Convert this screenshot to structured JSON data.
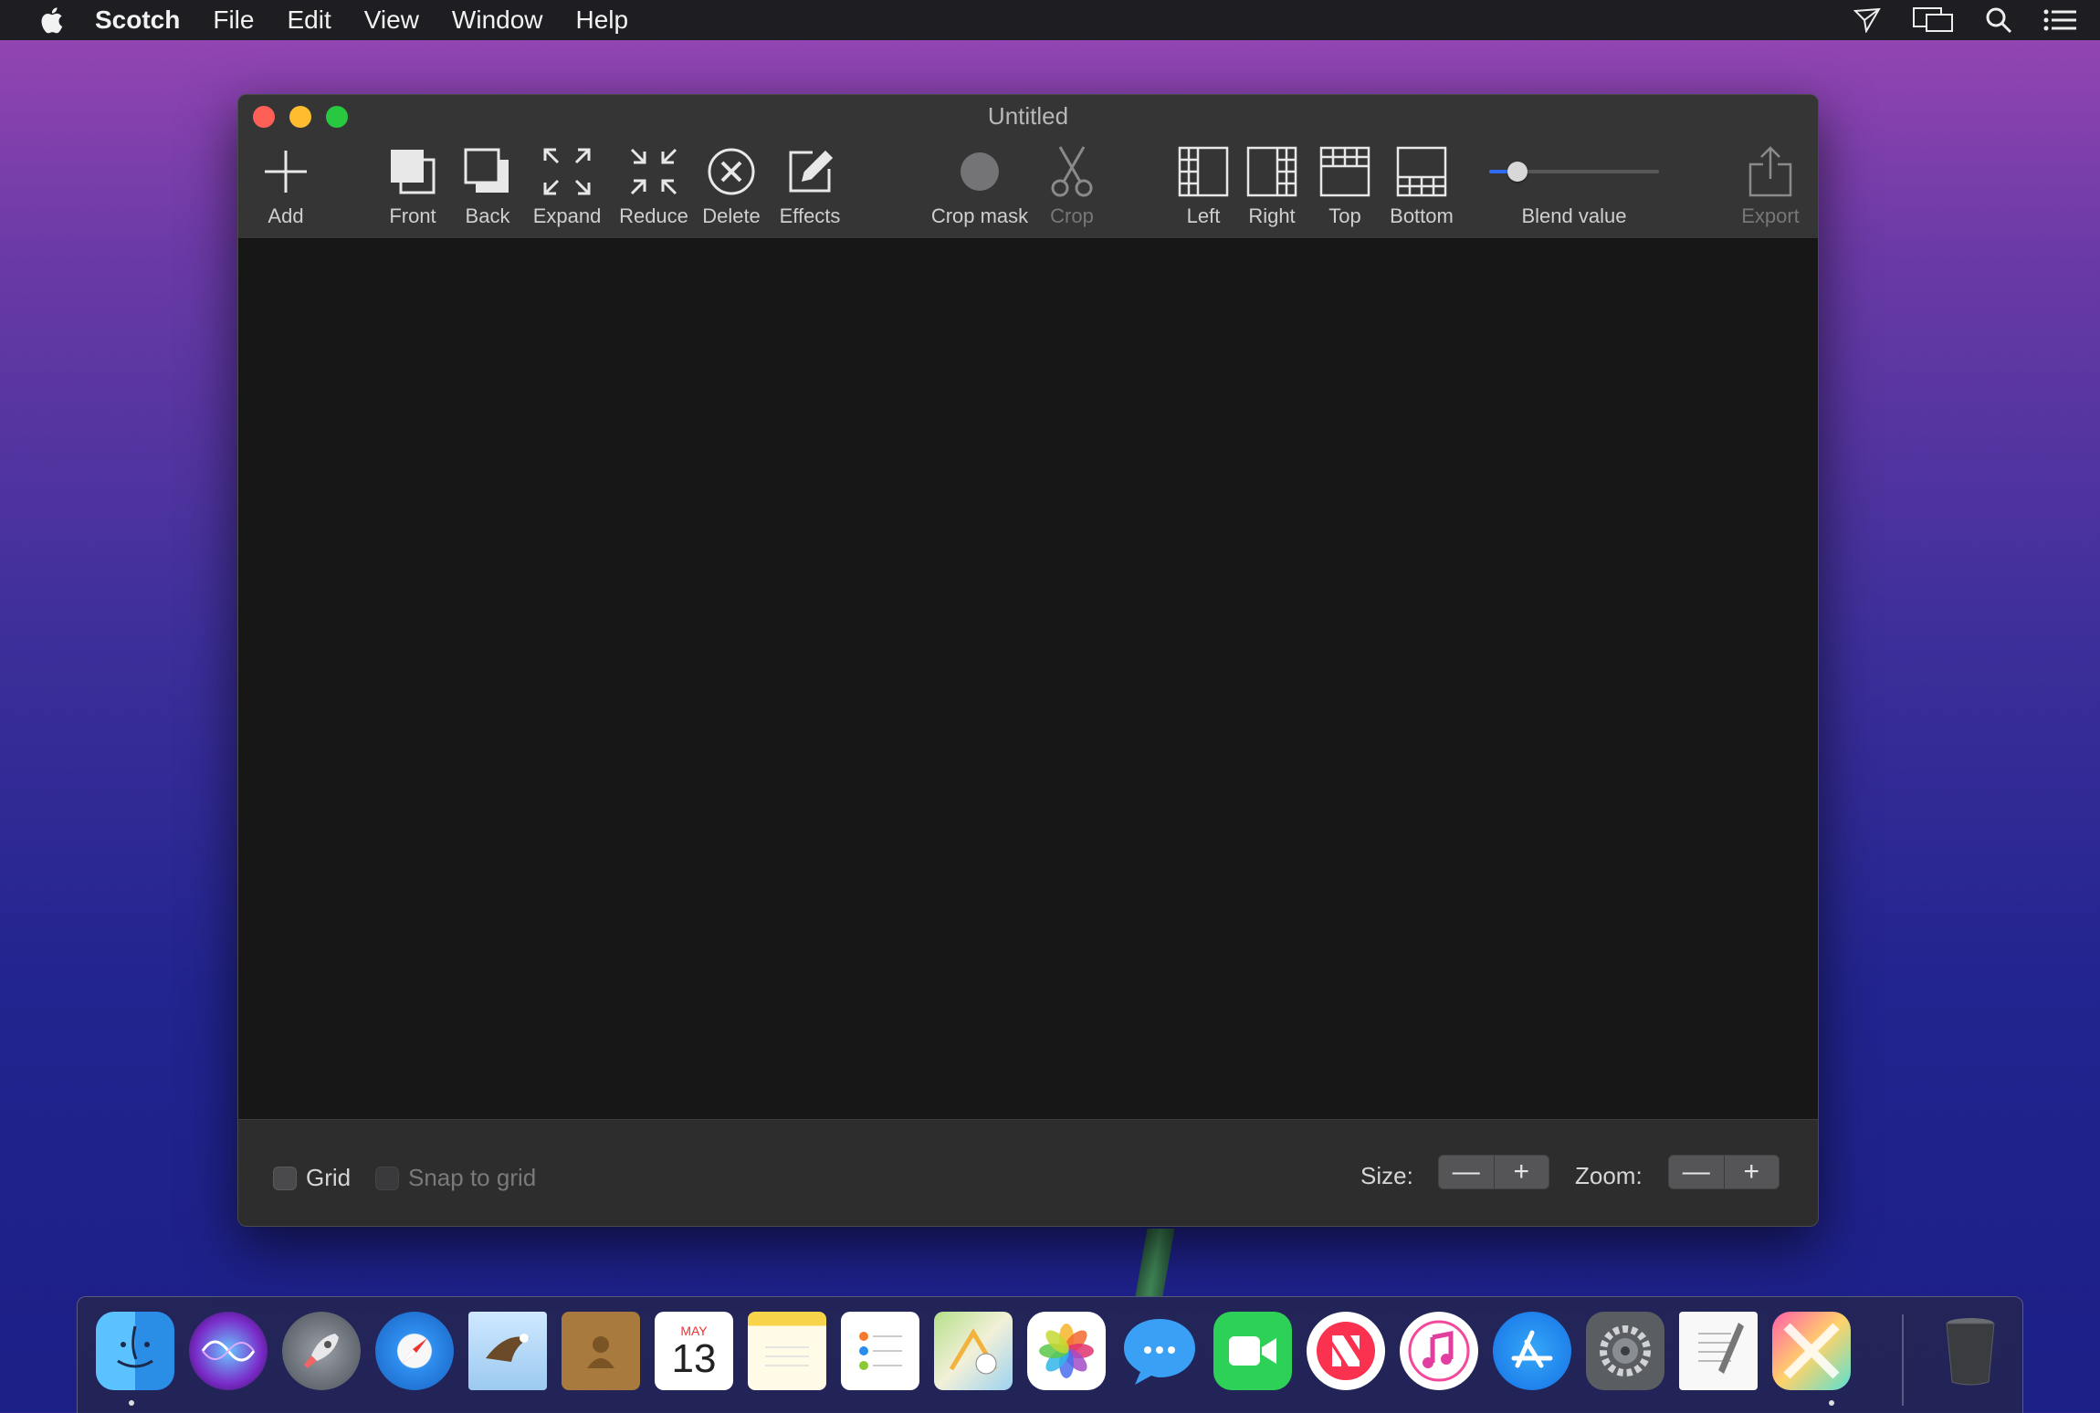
{
  "menubar": {
    "app_name": "Scotch",
    "items": [
      "File",
      "Edit",
      "View",
      "Window",
      "Help"
    ],
    "status_icons": [
      "airdrop-icon",
      "display-mirroring-icon",
      "spotlight-search-icon",
      "notification-center-icon"
    ]
  },
  "window": {
    "title": "Untitled",
    "toolbar": {
      "add": "Add",
      "front": "Front",
      "back": "Back",
      "expand": "Expand",
      "reduce": "Reduce",
      "delete": "Delete",
      "effects": "Effects",
      "crop_mask": "Crop mask",
      "crop": "Crop",
      "left": "Left",
      "right": "Right",
      "top": "Top",
      "bottom": "Bottom",
      "blend_value": "Blend value",
      "blend_value_fraction": 0.12,
      "export": "Export"
    },
    "bottombar": {
      "grid": "Grid",
      "grid_checked": false,
      "snap_to_grid": "Snap to grid",
      "snap_checked": false,
      "size_label": "Size:",
      "zoom_label": "Zoom:",
      "minus": "—",
      "plus": "+"
    }
  },
  "dock": {
    "calendar_month": "MAY",
    "calendar_day": "13",
    "apps": [
      "Finder",
      "Siri",
      "Launchpad",
      "Safari",
      "Mail",
      "Contacts",
      "Calendar",
      "Notes",
      "Reminders",
      "Maps",
      "Photos",
      "Messages",
      "FaceTime",
      "News",
      "iTunes",
      "App Store",
      "System Preferences",
      "TextEdit",
      "Scotch",
      "Trash"
    ]
  },
  "colors": {
    "close": "#fe5f57",
    "minimize": "#febc2e",
    "maximize": "#28c840",
    "accent": "#2f6bf0"
  }
}
